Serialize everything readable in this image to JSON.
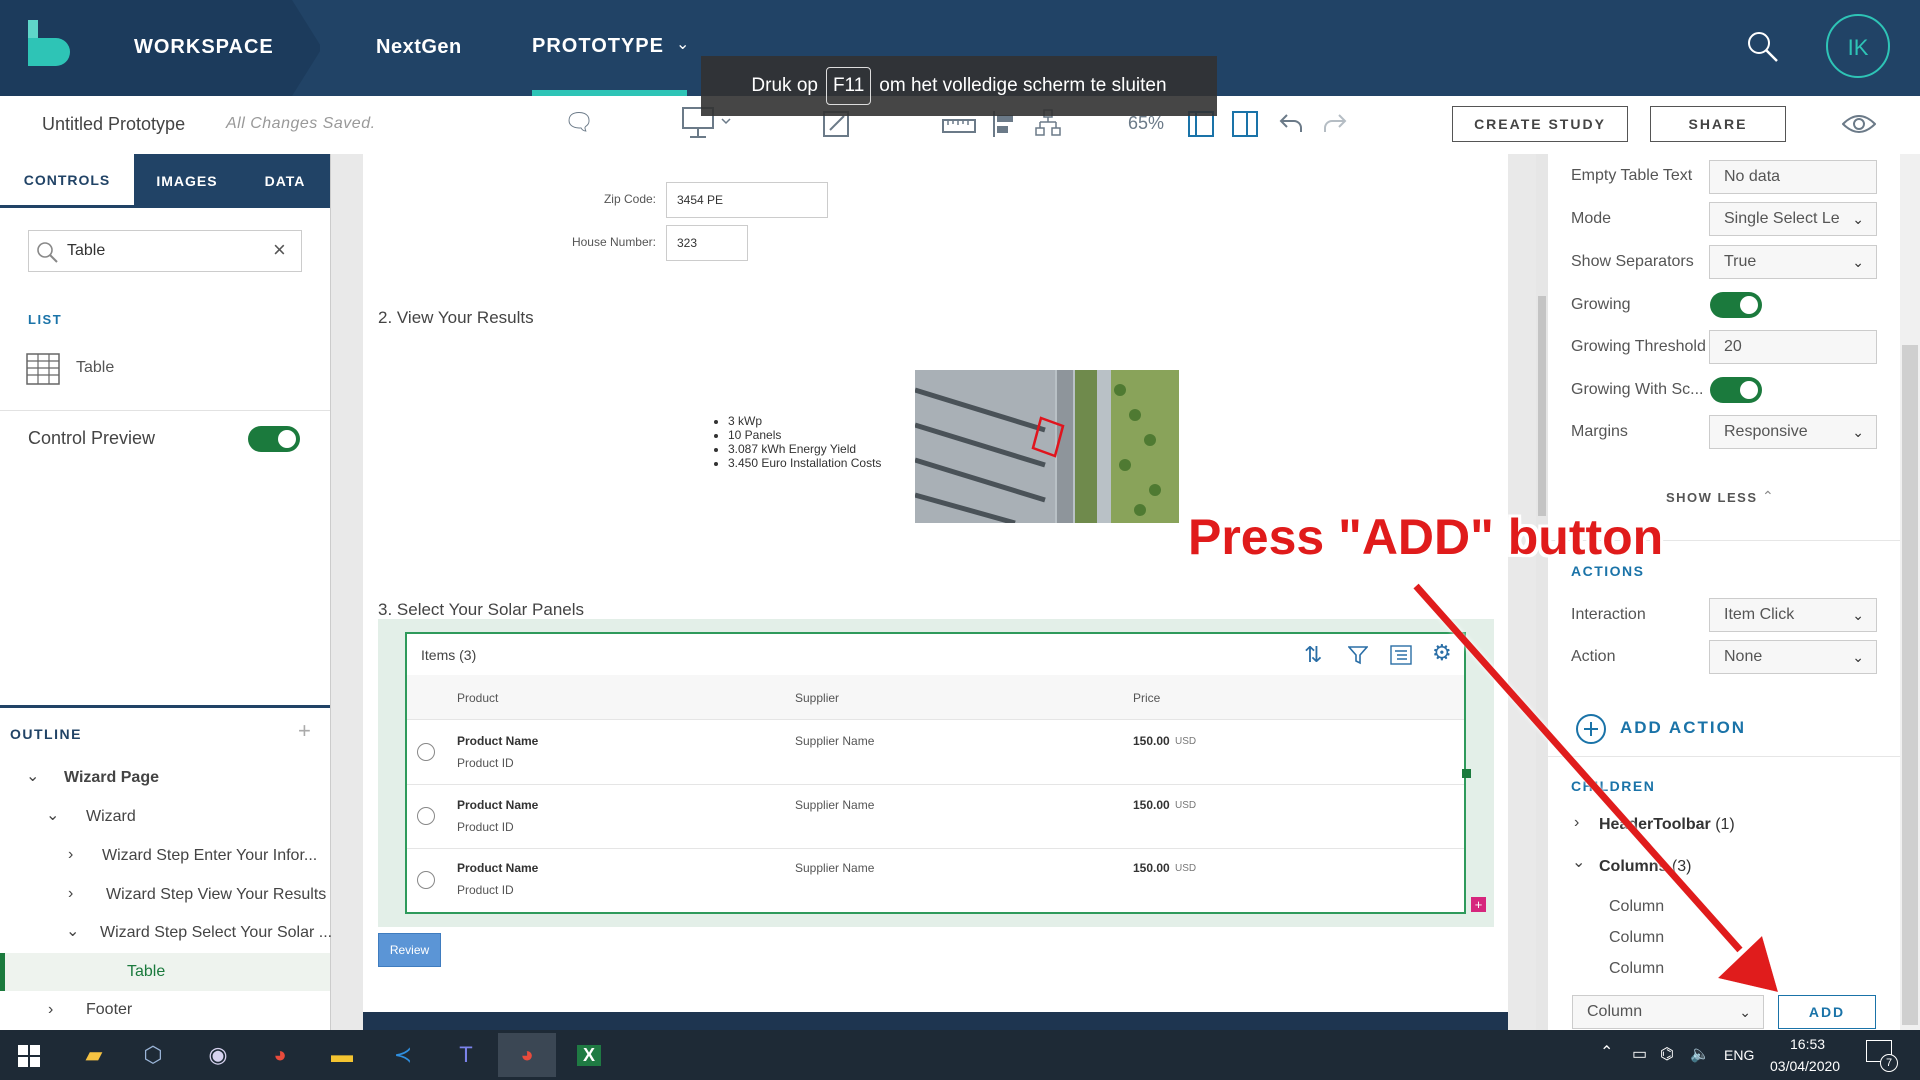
{
  "nav": {
    "workspace": "WORKSPACE",
    "project": "NextGen",
    "prototype": "PROTOTYPE",
    "avatar": "IK",
    "fullscreen_prefix": "Druk op",
    "fullscreen_key": "F11",
    "fullscreen_suffix": "om het volledige scherm te sluiten"
  },
  "toolbar": {
    "title": "Untitled Prototype",
    "status": "All Changes Saved.",
    "zoom": "65%",
    "create_study": "CREATE STUDY",
    "share": "SHARE"
  },
  "left": {
    "tabs": [
      "CONTROLS",
      "IMAGES",
      "DATA"
    ],
    "search_value": "Table",
    "list_header": "LIST",
    "list_item": "Table",
    "control_preview": "Control Preview",
    "outline_header": "OUTLINE",
    "outline": [
      "Wizard Page",
      "Wizard",
      "Wizard Step Enter Your Infor...",
      "Wizard Step View Your Results",
      "Wizard Step Select Your Solar ...",
      "Table",
      "Footer"
    ]
  },
  "canvas": {
    "zip_label": "Zip Code:",
    "zip_value": "3454 PE",
    "house_label": "House Number:",
    "house_value": "323",
    "step2": "2. View Your Results",
    "bullets": [
      "3 kWp",
      "10 Panels",
      "3.087 kWh Energy Yield",
      "3.450 Euro Installation Costs"
    ],
    "step3": "3. Select Your Solar Panels",
    "table_title": "Items (3)",
    "columns": [
      "Product",
      "Supplier",
      "Price"
    ],
    "rows": [
      {
        "product": "Product Name",
        "id": "Product ID",
        "supplier": "Supplier Name",
        "price": "150.00",
        "currency": "USD"
      },
      {
        "product": "Product Name",
        "id": "Product ID",
        "supplier": "Supplier Name",
        "price": "150.00",
        "currency": "USD"
      },
      {
        "product": "Product Name",
        "id": "Product ID",
        "supplier": "Supplier Name",
        "price": "150.00",
        "currency": "USD"
      }
    ],
    "review": "Review"
  },
  "right": {
    "props": [
      {
        "label": "Empty Table Text",
        "value": "No data",
        "type": "text"
      },
      {
        "label": "Mode",
        "value": "Single Select Le",
        "type": "select"
      },
      {
        "label": "Show Separators",
        "value": "True",
        "type": "select"
      },
      {
        "label": "Growing",
        "value": "",
        "type": "toggle"
      },
      {
        "label": "Growing Threshold",
        "value": "20",
        "type": "text"
      },
      {
        "label": "Growing With Sc...",
        "value": "",
        "type": "toggle"
      },
      {
        "label": "Margins",
        "value": "Responsive",
        "type": "select"
      }
    ],
    "show_less": "SHOW LESS",
    "actions_header": "ACTIONS",
    "interaction_label": "Interaction",
    "interaction_value": "Item Click",
    "action_label": "Action",
    "action_value": "None",
    "add_action": "ADD ACTION",
    "children_header": "CHILDREN",
    "header_toolbar": "HeaderToolbar",
    "header_toolbar_count": "(1)",
    "columns": "Columns",
    "columns_count": "(3)",
    "column_items": [
      "Column",
      "Column",
      "Column"
    ],
    "child_type_value": "Column",
    "add": "ADD"
  },
  "annotation": "Press \"ADD\" button",
  "taskbar": {
    "lang": "ENG",
    "time": "16:53",
    "date": "03/04/2020",
    "notif": "7"
  },
  "colors": {
    "nav_bg": "#214366",
    "accent": "#2ec4b6",
    "toggle_on": "#1b7a3d",
    "annotation": "#e01b1b",
    "table_border": "#2e9a5b"
  }
}
